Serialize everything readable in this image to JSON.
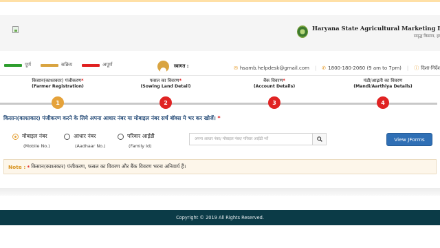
{
  "header": {
    "org_title": "Haryana State Agricultural Marketing Board",
    "org_tagline": "समृद्ध किसान, हमारी पहचान"
  },
  "legend": [
    {
      "label": "पूर्ण",
      "color": "#2e9e2e"
    },
    {
      "label": "सक्रिय",
      "color": "#d9a441"
    },
    {
      "label": "अपूर्ण",
      "color": "#e02020"
    }
  ],
  "user": {
    "welcome": "स्वागत :"
  },
  "contacts": {
    "email": "hsamb.helpdesk@gmail.com",
    "phone": "1800-180-2060 (9 am to 7pm)",
    "guidelines": "दिशा-निर्देश"
  },
  "steps": [
    {
      "title": "किसान(काश्तकार) पंजीकरण",
      "subtitle": "(Farmer Registration)",
      "number": "1",
      "color": "#e5a23a"
    },
    {
      "title": "फसल का विवरण",
      "subtitle": "(Sowing Land Detail)",
      "number": "2",
      "color": "#e02323"
    },
    {
      "title": "बैंक विवरण",
      "subtitle": "(Account Details)",
      "number": "3",
      "color": "#e02323"
    },
    {
      "title": "मंडी/आढ़ती का विवरण",
      "subtitle": "(Mandi/Aarthiya Details)",
      "number": "4",
      "color": "#e02323"
    }
  ],
  "instruction": "किसान(काश्तकार) पंजीकरण करने के लिये अपना आधार नंबर या मोबाइल नंबर सर्च बॉक्स मे भर कर खोजें।",
  "search_options": [
    {
      "label": "मोबाइल नंबर",
      "sublabel": "(Mobile No.)",
      "checked": true
    },
    {
      "label": "आधार नंबर",
      "sublabel": "(Aadhaar No.)",
      "checked": false
    },
    {
      "label": "परिवार आईडी",
      "sublabel": "(Family Id)",
      "checked": false
    }
  ],
  "search": {
    "placeholder": "अपना आधार नंबर/ मोबाइल नंबर/ परिवार आईडी भरें"
  },
  "view_button": "View JForms",
  "note": {
    "label": "Note :",
    "text": "किसान(काश्तकार) पंजीकरण, फसल का विवरण और बैंक विवरण भरना अनिवार्य हैं।"
  },
  "footer": {
    "copyright": "Copyright © 2019 All Rights Reserved."
  }
}
